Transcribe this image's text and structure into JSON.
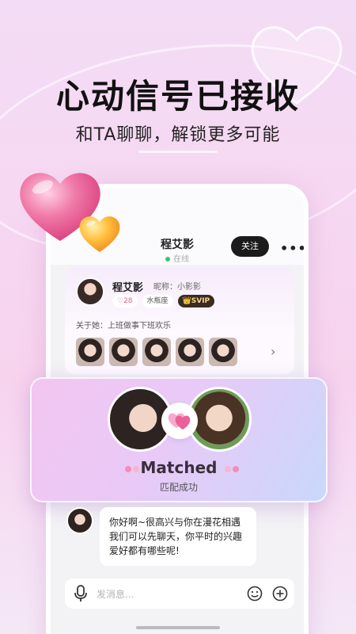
{
  "hero": {
    "headline": "心动信号已接收",
    "subheadline": "和TA聊聊，解锁更多可能"
  },
  "chat": {
    "contact_name": "程艾影",
    "status": "在线",
    "follow_label": "关注",
    "more_label": "•••"
  },
  "profile": {
    "name": "程艾影",
    "nickname": "昵称：小影影",
    "likes": "♡28",
    "zodiac": "水瓶座",
    "vip": "👑SVIP",
    "about": "关于她：上班做事下班欢乐",
    "photo_count": 5,
    "arrow": "›"
  },
  "matched": {
    "title": "Matched",
    "subtitle": "匹配成功"
  },
  "message": {
    "text": "你好啊~很高兴与你在漫花相遇我们可以先聊天，你平时的兴趣爱好都有哪些呢!"
  },
  "input": {
    "placeholder": "发消息..."
  },
  "colors": {
    "accent_pink": "#f07aa8",
    "vip_gold": "#f6d28c",
    "online_green": "#3cc46a"
  }
}
